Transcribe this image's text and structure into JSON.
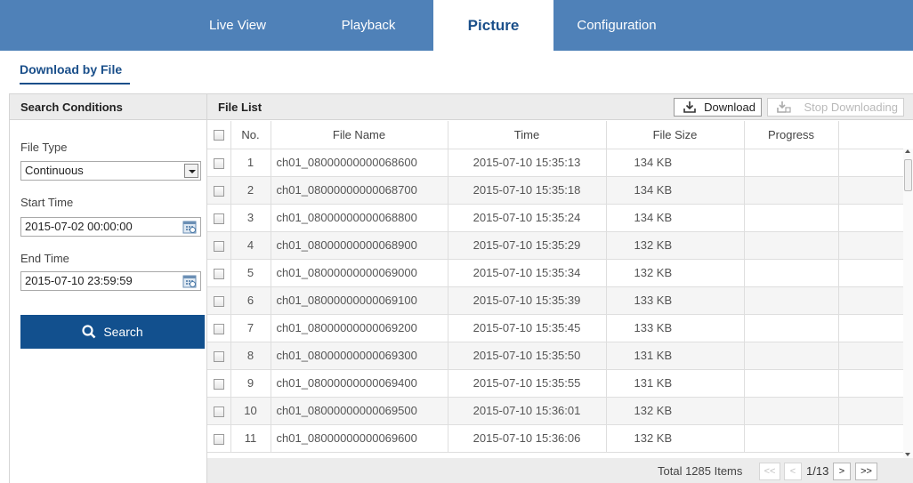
{
  "nav": {
    "tabs": [
      {
        "label": "Live View",
        "active": false
      },
      {
        "label": "Playback",
        "active": false
      },
      {
        "label": "Picture",
        "active": true
      },
      {
        "label": "Configuration",
        "active": false
      }
    ]
  },
  "subheader": {
    "title": "Download by File"
  },
  "search": {
    "header": "Search Conditions",
    "file_type_label": "File Type",
    "file_type_value": "Continuous",
    "start_time_label": "Start Time",
    "start_time_value": "2015-07-02 00:00:00",
    "end_time_label": "End Time",
    "end_time_value": "2015-07-10 23:59:59",
    "search_button": "Search"
  },
  "file_list": {
    "header": "File List",
    "download_button": "Download",
    "stop_button": "Stop Downloading",
    "columns": [
      "No.",
      "File Name",
      "Time",
      "File Size",
      "Progress"
    ],
    "rows": [
      {
        "no": "1",
        "name": "ch01_08000000000068600",
        "time": "2015-07-10 15:35:13",
        "size": "134 KB",
        "progress": ""
      },
      {
        "no": "2",
        "name": "ch01_08000000000068700",
        "time": "2015-07-10 15:35:18",
        "size": "134 KB",
        "progress": ""
      },
      {
        "no": "3",
        "name": "ch01_08000000000068800",
        "time": "2015-07-10 15:35:24",
        "size": "134 KB",
        "progress": ""
      },
      {
        "no": "4",
        "name": "ch01_08000000000068900",
        "time": "2015-07-10 15:35:29",
        "size": "132 KB",
        "progress": ""
      },
      {
        "no": "5",
        "name": "ch01_08000000000069000",
        "time": "2015-07-10 15:35:34",
        "size": "132 KB",
        "progress": ""
      },
      {
        "no": "6",
        "name": "ch01_08000000000069100",
        "time": "2015-07-10 15:35:39",
        "size": "133 KB",
        "progress": ""
      },
      {
        "no": "7",
        "name": "ch01_08000000000069200",
        "time": "2015-07-10 15:35:45",
        "size": "133 KB",
        "progress": ""
      },
      {
        "no": "8",
        "name": "ch01_08000000000069300",
        "time": "2015-07-10 15:35:50",
        "size": "131 KB",
        "progress": ""
      },
      {
        "no": "9",
        "name": "ch01_08000000000069400",
        "time": "2015-07-10 15:35:55",
        "size": "131 KB",
        "progress": ""
      },
      {
        "no": "10",
        "name": "ch01_08000000000069500",
        "time": "2015-07-10 15:36:01",
        "size": "132 KB",
        "progress": ""
      },
      {
        "no": "11",
        "name": "ch01_08000000000069600",
        "time": "2015-07-10 15:36:06",
        "size": "132 KB",
        "progress": ""
      }
    ],
    "pagination": {
      "total": "Total 1285 Items",
      "first": "<<",
      "prev": "<",
      "page": "1/13",
      "next": ">",
      "last": ">>"
    }
  },
  "colors": {
    "nav_bg": "#4f81b8",
    "accent": "#12508e",
    "header_bg": "#ececec"
  },
  "icons": [
    "calendar-icon",
    "search-icon",
    "download-icon",
    "stop-download-icon",
    "chevron-down-icon"
  ]
}
